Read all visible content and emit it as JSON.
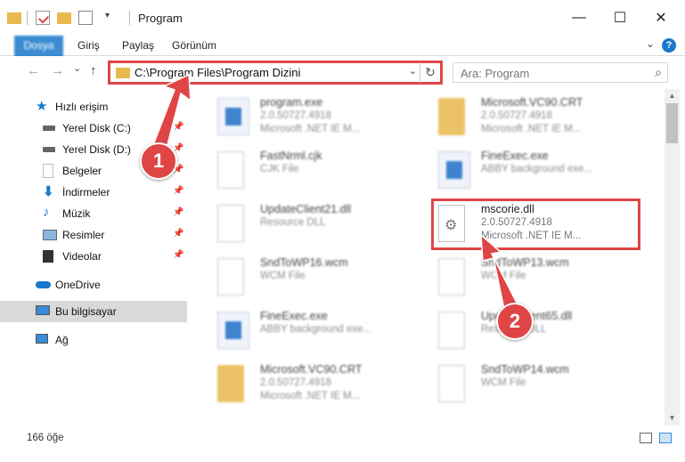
{
  "window": {
    "title": "Program",
    "minimize_glyph": "—",
    "maximize_glyph": "☐",
    "close_glyph": "✕"
  },
  "ribbon": {
    "tabs": [
      "Dosya",
      "Giriş",
      "Paylaş",
      "Görünüm"
    ],
    "help_glyph": "?"
  },
  "nav": {
    "back_glyph": "←",
    "forward_glyph": "→",
    "recent_glyph": "⌄",
    "up_glyph": "↑",
    "address": "C:\\Program Files\\Program Dizini",
    "dropdown_glyph": "⌄",
    "refresh_glyph": "↻",
    "search_placeholder": "Ara: Program",
    "search_glyph": "⌕"
  },
  "sidebar": {
    "items": [
      {
        "label": "Hızlı erişim",
        "icon": "star-icon"
      },
      {
        "label": "Yerel Disk (C:)",
        "icon": "drive-icon"
      },
      {
        "label": "Yerel Disk (D:)",
        "icon": "drive-icon"
      },
      {
        "label": "Belgeler",
        "icon": "documents-icon"
      },
      {
        "label": "İndirmeler",
        "icon": "download-icon"
      },
      {
        "label": "Müzik",
        "icon": "music-icon"
      },
      {
        "label": "Resimler",
        "icon": "pictures-icon"
      },
      {
        "label": "Videolar",
        "icon": "videos-icon"
      },
      {
        "label": "OneDrive",
        "icon": "cloud-icon"
      },
      {
        "label": "Bu bilgisayar",
        "icon": "computer-icon"
      },
      {
        "label": "Ağ",
        "icon": "network-icon"
      }
    ],
    "pin_glyph": "📌"
  },
  "files": [
    {
      "name": "program.exe",
      "line2": "2.0.50727.4918",
      "line3": "Microsoft .NET IE M...",
      "icon": "exe"
    },
    {
      "name": "Microsoft.VC90.CRT",
      "line2": "2.0.50727.4918",
      "line3": "Microsoft .NET IE M...",
      "icon": "folder"
    },
    {
      "name": "FastNrml.cjk",
      "line2": "CJK File",
      "line3": "",
      "icon": "doc"
    },
    {
      "name": "FineExec.exe",
      "line2": "ABBY background exe...",
      "line3": "",
      "icon": "exe"
    },
    {
      "name": "UpdateClient21.dll",
      "line2": "Resource DLL",
      "line3": "",
      "icon": "dll"
    },
    {
      "name": "mscorie.dll",
      "line2": "2.0.50727.4918",
      "line3": "Microsoft .NET IE M...",
      "icon": "dll"
    },
    {
      "name": "SndToWP16.wcm",
      "line2": "WCM File",
      "line3": "",
      "icon": "doc"
    },
    {
      "name": "SndToWP13.wcm",
      "line2": "WCM File",
      "line3": "",
      "icon": "doc"
    },
    {
      "name": "FineExec.exe",
      "line2": "ABBY background exe...",
      "line3": "",
      "icon": "exe"
    },
    {
      "name": "UpdateClient65.dll",
      "line2": "Resource DLL",
      "line3": "",
      "icon": "dll"
    },
    {
      "name": "Microsoft.VC90.CRT",
      "line2": "2.0.50727.4918",
      "line3": "Microsoft .NET IE M...",
      "icon": "folder"
    },
    {
      "name": "SndToWP14.wcm",
      "line2": "WCM File",
      "line3": "",
      "icon": "doc"
    }
  ],
  "scrollbar": {
    "up_glyph": "▲",
    "down_glyph": "▼"
  },
  "status": {
    "item_count": "166 öğe"
  },
  "callouts": [
    "1",
    "2"
  ],
  "colors": {
    "accent": "#1979ca",
    "highlight": "#e04545",
    "folder": "#e8b94c"
  }
}
